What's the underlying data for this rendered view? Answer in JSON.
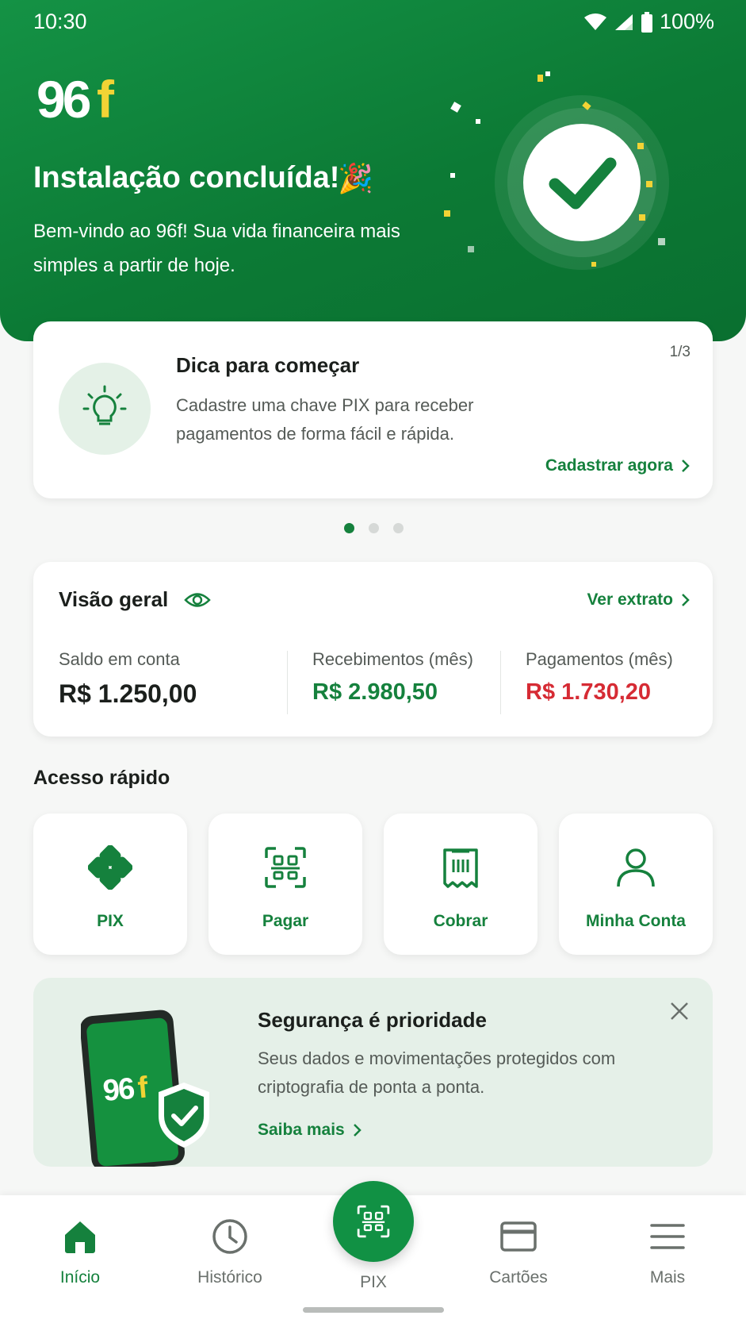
{
  "status_bar": {
    "time": "10:30",
    "battery": "100%"
  },
  "brand": {
    "logo_text": "96f",
    "primary": "#15813d",
    "accent": "#f2d335"
  },
  "hero": {
    "title": "Instalação concluída!",
    "title_icon": "🎉",
    "subtitle": "Bem-vindo ao 96f! Sua vida financeira mais simples a partir de hoje."
  },
  "tip": {
    "title": "Dica para começar",
    "body": "Cadastre uma chave PIX para receber pagamentos de forma fácil e rápida.",
    "counter": "1/3",
    "link": "Cadastrar agora",
    "icon": "lightbulb-icon"
  },
  "carousel": {
    "active_index": 0,
    "count": 3
  },
  "overview": {
    "title": "Visão geral",
    "link": "Ver extrato",
    "balance": {
      "label": "Saldo em conta",
      "value": "R$ 1.250,00"
    },
    "income": {
      "label": "Recebimentos (mês)",
      "value": "R$ 2.980,50",
      "color": "#15813d"
    },
    "expense": {
      "label": "Pagamentos (mês)",
      "value": "R$ 1.730,20",
      "color": "#d62b34"
    }
  },
  "quick_access": {
    "title": "Acesso rápido",
    "items": [
      {
        "label": "PIX",
        "icon": "pix-icon"
      },
      {
        "label": "Pagar",
        "icon": "qr-scan-icon"
      },
      {
        "label": "Cobrar",
        "icon": "receipt-icon"
      },
      {
        "label": "Minha Conta",
        "icon": "user-icon"
      }
    ]
  },
  "security": {
    "title": "Segurança é prioridade",
    "body": "Seus dados e movimentações protegidos com criptografia de ponta a ponta.",
    "link": "Saiba mais",
    "phone_logo": "96f"
  },
  "bottom_nav": {
    "items": [
      {
        "label": "Início",
        "icon": "home-icon",
        "active": true
      },
      {
        "label": "Histórico",
        "icon": "history-icon"
      },
      {
        "label": "PIX",
        "icon": "qr-scan-icon"
      },
      {
        "label": "Cartões",
        "icon": "card-icon"
      },
      {
        "label": "Mais",
        "icon": "menu-icon"
      }
    ]
  }
}
